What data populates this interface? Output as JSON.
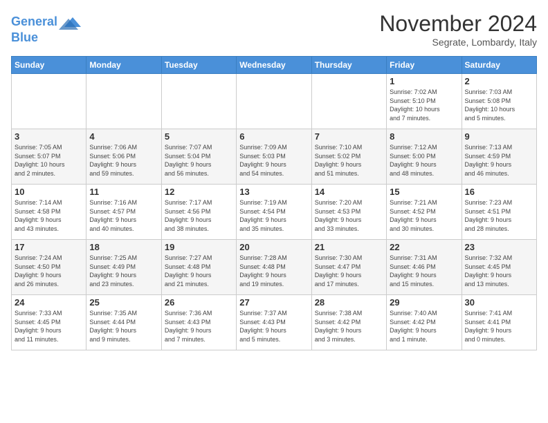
{
  "header": {
    "logo_line1": "General",
    "logo_line2": "Blue",
    "month": "November 2024",
    "location": "Segrate, Lombardy, Italy"
  },
  "weekdays": [
    "Sunday",
    "Monday",
    "Tuesday",
    "Wednesday",
    "Thursday",
    "Friday",
    "Saturday"
  ],
  "weeks": [
    [
      {
        "day": "",
        "info": ""
      },
      {
        "day": "",
        "info": ""
      },
      {
        "day": "",
        "info": ""
      },
      {
        "day": "",
        "info": ""
      },
      {
        "day": "",
        "info": ""
      },
      {
        "day": "1",
        "info": "Sunrise: 7:02 AM\nSunset: 5:10 PM\nDaylight: 10 hours\nand 7 minutes."
      },
      {
        "day": "2",
        "info": "Sunrise: 7:03 AM\nSunset: 5:08 PM\nDaylight: 10 hours\nand 5 minutes."
      }
    ],
    [
      {
        "day": "3",
        "info": "Sunrise: 7:05 AM\nSunset: 5:07 PM\nDaylight: 10 hours\nand 2 minutes."
      },
      {
        "day": "4",
        "info": "Sunrise: 7:06 AM\nSunset: 5:06 PM\nDaylight: 9 hours\nand 59 minutes."
      },
      {
        "day": "5",
        "info": "Sunrise: 7:07 AM\nSunset: 5:04 PM\nDaylight: 9 hours\nand 56 minutes."
      },
      {
        "day": "6",
        "info": "Sunrise: 7:09 AM\nSunset: 5:03 PM\nDaylight: 9 hours\nand 54 minutes."
      },
      {
        "day": "7",
        "info": "Sunrise: 7:10 AM\nSunset: 5:02 PM\nDaylight: 9 hours\nand 51 minutes."
      },
      {
        "day": "8",
        "info": "Sunrise: 7:12 AM\nSunset: 5:00 PM\nDaylight: 9 hours\nand 48 minutes."
      },
      {
        "day": "9",
        "info": "Sunrise: 7:13 AM\nSunset: 4:59 PM\nDaylight: 9 hours\nand 46 minutes."
      }
    ],
    [
      {
        "day": "10",
        "info": "Sunrise: 7:14 AM\nSunset: 4:58 PM\nDaylight: 9 hours\nand 43 minutes."
      },
      {
        "day": "11",
        "info": "Sunrise: 7:16 AM\nSunset: 4:57 PM\nDaylight: 9 hours\nand 40 minutes."
      },
      {
        "day": "12",
        "info": "Sunrise: 7:17 AM\nSunset: 4:56 PM\nDaylight: 9 hours\nand 38 minutes."
      },
      {
        "day": "13",
        "info": "Sunrise: 7:19 AM\nSunset: 4:54 PM\nDaylight: 9 hours\nand 35 minutes."
      },
      {
        "day": "14",
        "info": "Sunrise: 7:20 AM\nSunset: 4:53 PM\nDaylight: 9 hours\nand 33 minutes."
      },
      {
        "day": "15",
        "info": "Sunrise: 7:21 AM\nSunset: 4:52 PM\nDaylight: 9 hours\nand 30 minutes."
      },
      {
        "day": "16",
        "info": "Sunrise: 7:23 AM\nSunset: 4:51 PM\nDaylight: 9 hours\nand 28 minutes."
      }
    ],
    [
      {
        "day": "17",
        "info": "Sunrise: 7:24 AM\nSunset: 4:50 PM\nDaylight: 9 hours\nand 26 minutes."
      },
      {
        "day": "18",
        "info": "Sunrise: 7:25 AM\nSunset: 4:49 PM\nDaylight: 9 hours\nand 23 minutes."
      },
      {
        "day": "19",
        "info": "Sunrise: 7:27 AM\nSunset: 4:48 PM\nDaylight: 9 hours\nand 21 minutes."
      },
      {
        "day": "20",
        "info": "Sunrise: 7:28 AM\nSunset: 4:48 PM\nDaylight: 9 hours\nand 19 minutes."
      },
      {
        "day": "21",
        "info": "Sunrise: 7:30 AM\nSunset: 4:47 PM\nDaylight: 9 hours\nand 17 minutes."
      },
      {
        "day": "22",
        "info": "Sunrise: 7:31 AM\nSunset: 4:46 PM\nDaylight: 9 hours\nand 15 minutes."
      },
      {
        "day": "23",
        "info": "Sunrise: 7:32 AM\nSunset: 4:45 PM\nDaylight: 9 hours\nand 13 minutes."
      }
    ],
    [
      {
        "day": "24",
        "info": "Sunrise: 7:33 AM\nSunset: 4:45 PM\nDaylight: 9 hours\nand 11 minutes."
      },
      {
        "day": "25",
        "info": "Sunrise: 7:35 AM\nSunset: 4:44 PM\nDaylight: 9 hours\nand 9 minutes."
      },
      {
        "day": "26",
        "info": "Sunrise: 7:36 AM\nSunset: 4:43 PM\nDaylight: 9 hours\nand 7 minutes."
      },
      {
        "day": "27",
        "info": "Sunrise: 7:37 AM\nSunset: 4:43 PM\nDaylight: 9 hours\nand 5 minutes."
      },
      {
        "day": "28",
        "info": "Sunrise: 7:38 AM\nSunset: 4:42 PM\nDaylight: 9 hours\nand 3 minutes."
      },
      {
        "day": "29",
        "info": "Sunrise: 7:40 AM\nSunset: 4:42 PM\nDaylight: 9 hours\nand 1 minute."
      },
      {
        "day": "30",
        "info": "Sunrise: 7:41 AM\nSunset: 4:41 PM\nDaylight: 9 hours\nand 0 minutes."
      }
    ]
  ]
}
